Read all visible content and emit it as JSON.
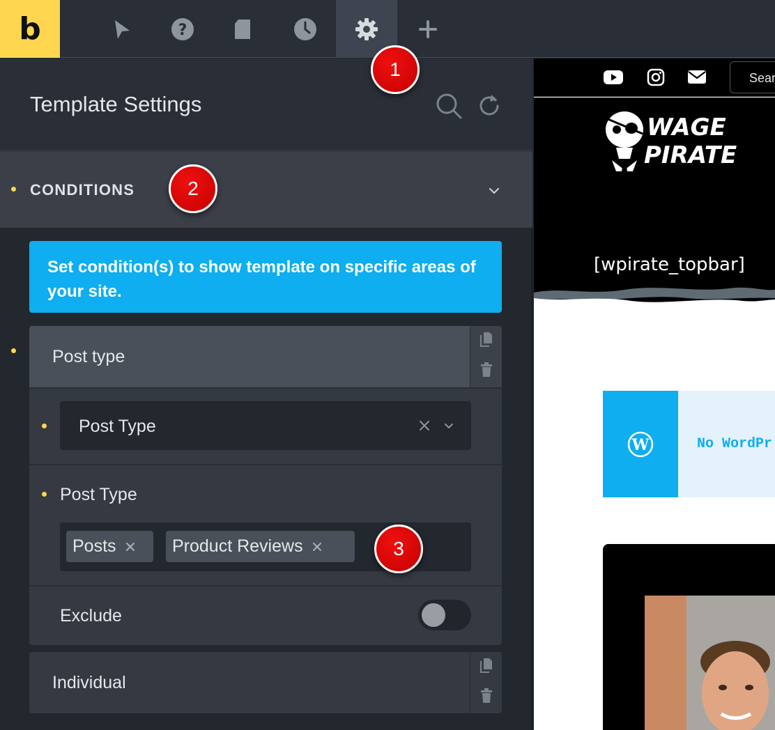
{
  "toolbar": {
    "logo_letter": "b",
    "buttons": [
      {
        "name": "pointer-icon",
        "active": false
      },
      {
        "name": "help-icon",
        "active": false
      },
      {
        "name": "page-icon",
        "active": false
      },
      {
        "name": "history-icon",
        "active": false
      },
      {
        "name": "gear-icon",
        "active": true
      },
      {
        "name": "plus-icon",
        "active": false
      }
    ]
  },
  "badges": {
    "one": "1",
    "two": "2",
    "three": "3"
  },
  "panel": {
    "title": "Template Settings",
    "search_icon": "search-icon",
    "reset_icon": "refresh-icon"
  },
  "conditions": {
    "title": "CONDITIONS",
    "info": "Set condition(s) to show template on specific areas of your site.",
    "groups": [
      {
        "label": "Post type",
        "select_value": "Post Type",
        "sub_label": "Post Type",
        "tags": [
          "Posts",
          "Product Reviews"
        ],
        "exclude_label": "Exclude",
        "exclude_on": false
      },
      {
        "label": "Individual"
      }
    ]
  },
  "preview": {
    "search_text": "Sear",
    "shortcode": "[wpirate_topbar]",
    "logo_line1": "WAGE",
    "logo_line2": "PIRATE",
    "wp_notice": "No WordPr"
  },
  "colors": {
    "accent_yellow": "#ffd64f",
    "info_blue": "#0eaef0",
    "badge_red": "#d40000"
  }
}
